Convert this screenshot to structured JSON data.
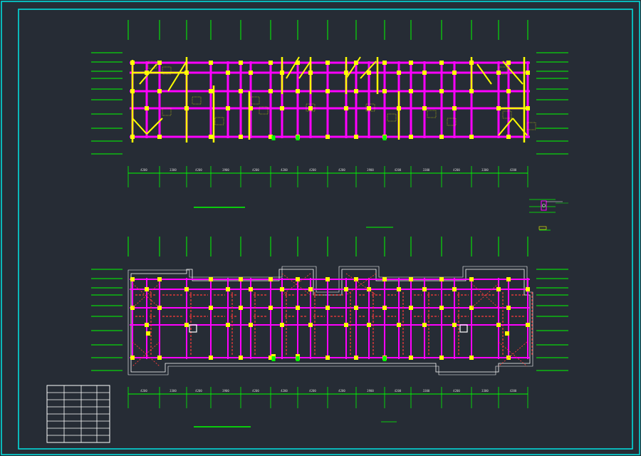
{
  "drawing": {
    "sheet_label": "CAD structural floor plan sheet",
    "colors": {
      "background": "#262c35",
      "frame": "#00e5e5",
      "grid": "#00ff00",
      "beam": "#ff00ff",
      "wall": "#ffff00",
      "column": "#ffff00",
      "rebar": "#ff3b3b",
      "text": "#d8d8d8",
      "table": "#ffffff"
    },
    "plans": [
      {
        "id": "upper",
        "kind": "beam-reinforcement"
      },
      {
        "id": "lower",
        "kind": "slab-reinforcement"
      }
    ],
    "bay_dims": [
      "4200",
      "3300",
      "4200",
      "3900",
      "4200",
      "4200",
      "4200",
      "4200",
      "3900",
      "4200",
      "3300",
      "4200",
      "3300",
      "4200"
    ],
    "title_block": {
      "rows": 8,
      "cols": 4
    }
  }
}
